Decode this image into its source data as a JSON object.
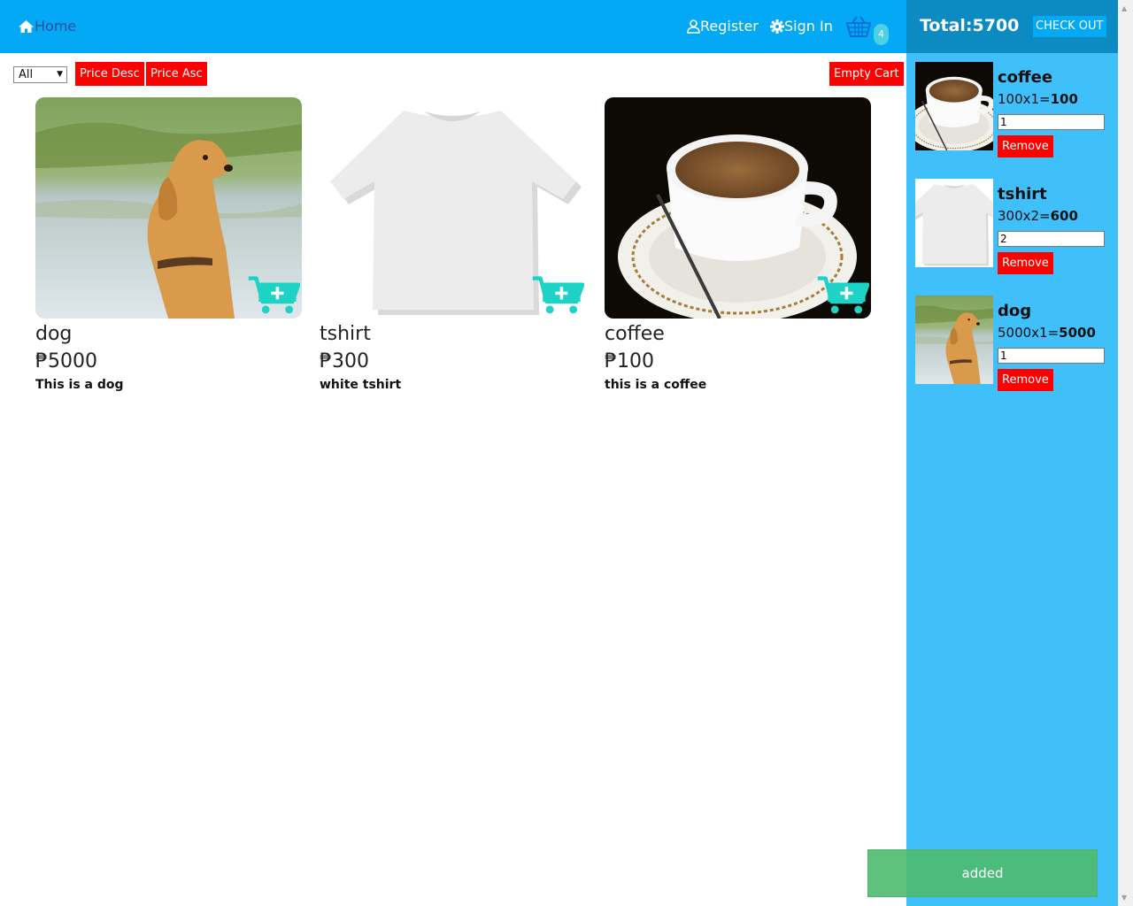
{
  "nav": {
    "home_label": "Home",
    "register_label": "Register",
    "signin_label": "Sign In",
    "cart_count": "4"
  },
  "controls": {
    "filter_value": "All",
    "price_desc_label": "Price Desc",
    "price_asc_label": "Price Asc",
    "empty_cart_label": "Empty Cart"
  },
  "products": [
    {
      "title": "dog",
      "price": "₱5000",
      "description": "This is a dog"
    },
    {
      "title": "tshirt",
      "price": "₱300",
      "description": "white tshirt"
    },
    {
      "title": "coffee",
      "price": "₱100",
      "description": "this is a coffee"
    }
  ],
  "cart": {
    "total_label": "Total:5700",
    "checkout_label": "CHECK OUT",
    "items": [
      {
        "name": "coffee",
        "calc": "100x1=",
        "subtotal": "100",
        "qty": "1",
        "remove_label": "Remove"
      },
      {
        "name": "tshirt",
        "calc": "300x2=",
        "subtotal": "600",
        "qty": "2",
        "remove_label": "Remove"
      },
      {
        "name": "dog",
        "calc": "5000x1=",
        "subtotal": "5000",
        "qty": "1",
        "remove_label": "Remove"
      }
    ]
  },
  "toast": {
    "message": "added"
  },
  "colors": {
    "navbar": "#03a9f4",
    "cart_bg": "#40c0fb",
    "cart_header": "#0c8ac2",
    "danger": "#ff0000",
    "accent_icon": "#1dd3c6",
    "toast": "#5cbf78"
  }
}
